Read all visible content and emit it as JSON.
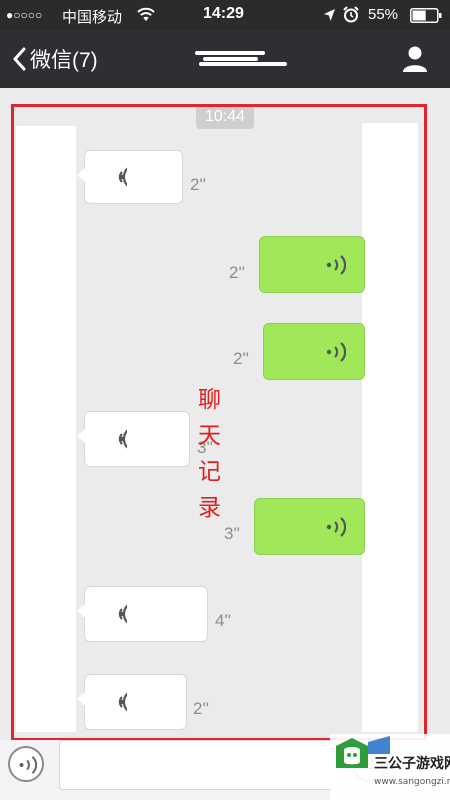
{
  "status_bar": {
    "signal": "●○○○○",
    "carrier": "中国移动",
    "time": "14:29",
    "battery_percent": "55%",
    "battery_level": 0.55
  },
  "nav": {
    "back_label": "微信(7)",
    "title": ""
  },
  "chat": {
    "timestamp": "10:44",
    "messages": [
      {
        "side": "in",
        "duration": "2''"
      },
      {
        "side": "out",
        "duration": "2''"
      },
      {
        "side": "out",
        "duration": "2''"
      },
      {
        "side": "in",
        "duration": "3''"
      },
      {
        "side": "out",
        "duration": "3''"
      },
      {
        "side": "in",
        "duration": "4''"
      },
      {
        "side": "in",
        "duration": "2''"
      }
    ]
  },
  "annotation": {
    "chars": [
      "聊",
      "天",
      "记",
      "录"
    ],
    "frame_color": "#e2242c"
  },
  "watermark": {
    "brand": "三公子游戏网",
    "url": "www.sangongzi.net"
  },
  "colors": {
    "outgoing_bubble": "#a0e75a",
    "incoming_bubble": "#ffffff",
    "nav_bar": "#2f2f33",
    "annotation_red": "#e02020"
  },
  "icons": [
    "wifi-icon",
    "location-arrow-icon",
    "alarm-icon",
    "battery-icon",
    "chevron-left-icon",
    "person-icon",
    "voice-wave-icon",
    "voice-input-icon",
    "emoji-icon"
  ]
}
